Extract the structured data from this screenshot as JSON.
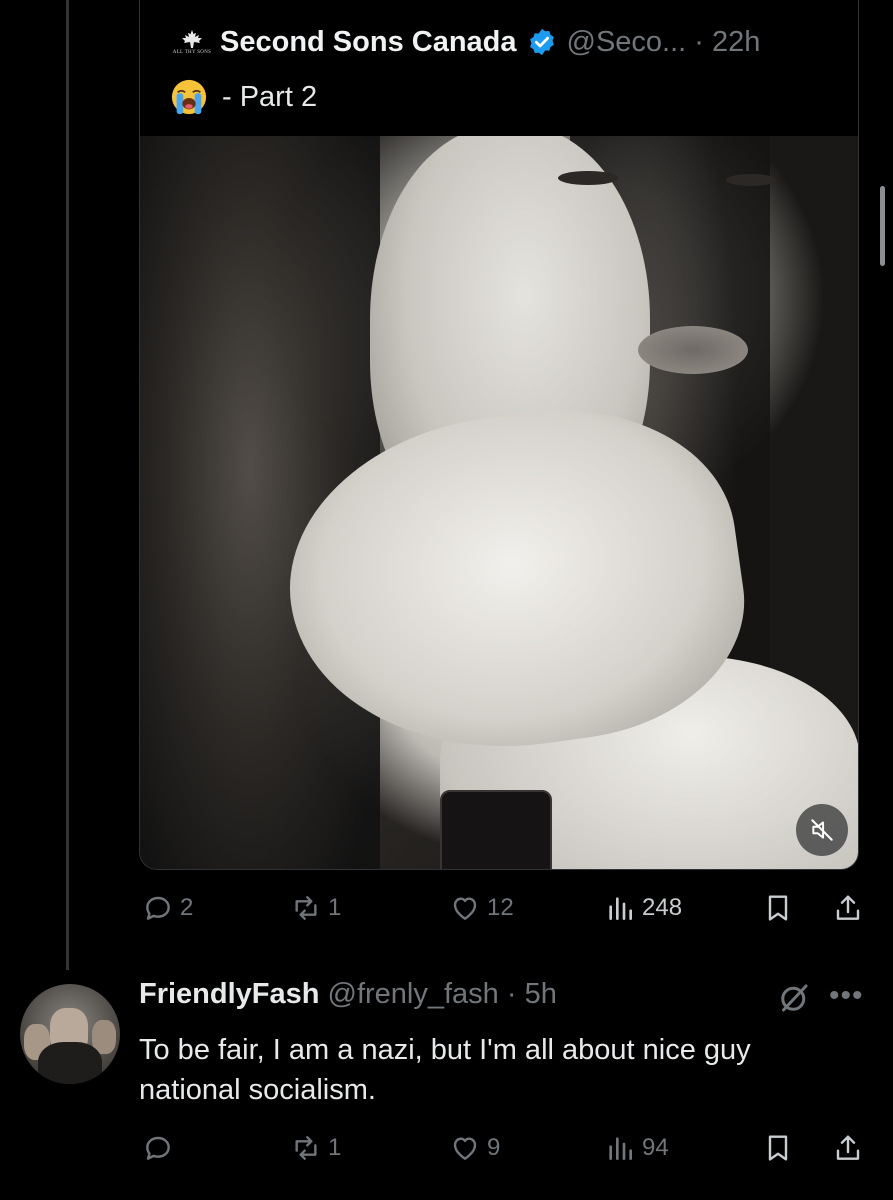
{
  "quoted_post": {
    "display_name": "Second Sons Canada",
    "avatar_caption": "ALL THY SONS",
    "handle_time": "@Seco... · 22h",
    "text": "- Part 2",
    "emoji_icon": "loudly-crying-face-icon",
    "media": {
      "type": "video",
      "muted_icon": "mute-icon"
    }
  },
  "quoted_actions": {
    "replies": "2",
    "reposts": "1",
    "likes": "12",
    "views": "248"
  },
  "reply_post": {
    "display_name": "FriendlyFash",
    "handle_time": "@frenly_fash · 5h",
    "text": "To be fair,  I am a nazi,  but I'm all about nice guy national socialism.",
    "grok_icon": "grok-icon",
    "more_icon": "more-icon"
  },
  "reply_actions": {
    "replies": "",
    "reposts": "1",
    "likes": "9",
    "views": "94"
  },
  "colors": {
    "background": "#000000",
    "text_primary": "#e7e9ea",
    "text_secondary": "#71767b",
    "verified_blue": "#1d9bf0",
    "divider": "#2f3336"
  }
}
